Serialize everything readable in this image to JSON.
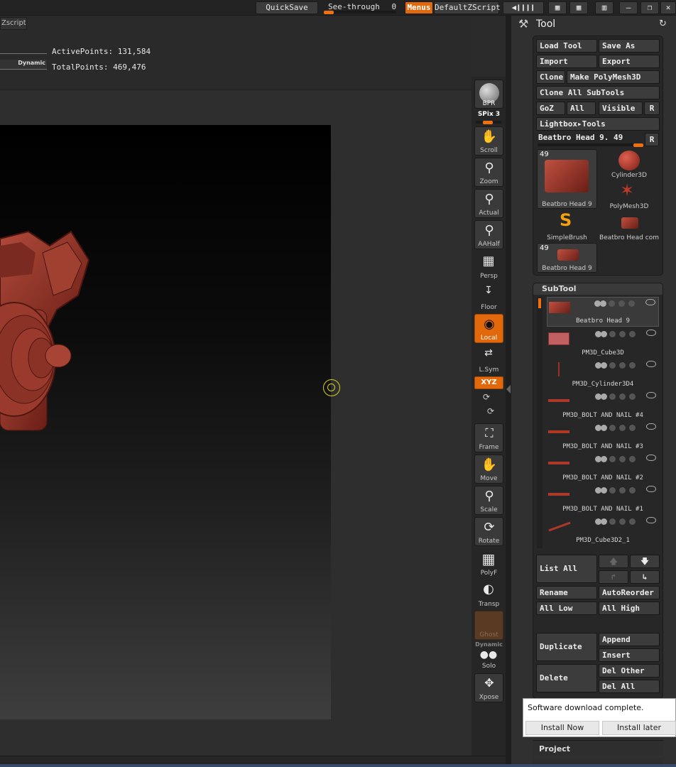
{
  "topbar": {
    "quicksave": "QuickSave",
    "seethrough_label": "See-through",
    "seethrough_value": "0",
    "menus": "Menus",
    "default_zscript": "DefaultZScript"
  },
  "left": {
    "zscript_tab": "Zscript",
    "dynamic_label": "Dynamic",
    "active_points": "ActivePoints: 131,584",
    "total_points": "TotalPoints: 469,476"
  },
  "shelf": {
    "bpr": "BPR",
    "spix": "SPix 3",
    "scroll": "Scroll",
    "zoom": "Zoom",
    "actual": "Actual",
    "aahalf": "AAHalf",
    "persp": "Persp",
    "floor": "Floor",
    "local": "Local",
    "lsym": "L.Sym",
    "xyz": "XYZ",
    "frame": "Frame",
    "move": "Move",
    "scale": "Scale",
    "rotate": "Rotate",
    "polyf": "PolyF",
    "transp": "Transp",
    "ghost": "Ghost",
    "dynamic": "Dynamic",
    "solo": "Solo",
    "xpose": "Xpose"
  },
  "tool": {
    "title": "Tool",
    "load_tool": "Load Tool",
    "save_as": "Save As",
    "import": "Import",
    "export": "Export",
    "clone": "Clone",
    "make_polymesh": "Make PolyMesh3D",
    "clone_all": "Clone All SubTools",
    "goz": "GoZ",
    "all": "All",
    "visible": "Visible",
    "r": "R",
    "lightbox": "Lightbox▸Tools",
    "current_tool": "Beatbro Head 9. 49",
    "thumbs": [
      {
        "num": "49",
        "label": "Beatbro Head 9"
      },
      {
        "label": "Cylinder3D"
      },
      {
        "label": "PolyMesh3D"
      },
      {
        "label": "SimpleBrush"
      },
      {
        "label": "Beatbro Head com"
      },
      {
        "num": "49",
        "label": "Beatbro Head 9"
      }
    ]
  },
  "subtool": {
    "title": "SubTool",
    "items": [
      "Beatbro Head 9",
      "PM3D_Cube3D",
      "PM3D_Cylinder3D4",
      "PM3D_BOLT AND NAIL #4",
      "PM3D_BOLT AND NAIL #3",
      "PM3D_BOLT AND NAIL #2",
      "PM3D_BOLT AND NAIL #1",
      "PM3D_Cube3D2_1"
    ],
    "list_all": "List All",
    "rename": "Rename",
    "autoreorder": "AutoReorder",
    "all_low": "All Low",
    "all_high": "All High",
    "duplicate": "Duplicate",
    "append": "Append",
    "insert": "Insert",
    "delete": "Delete",
    "del_other": "Del Other",
    "del_all": "Del All",
    "project": "Project"
  },
  "popup": {
    "message": "Software download complete.",
    "install_now": "Install Now",
    "install_later": "Install later"
  }
}
